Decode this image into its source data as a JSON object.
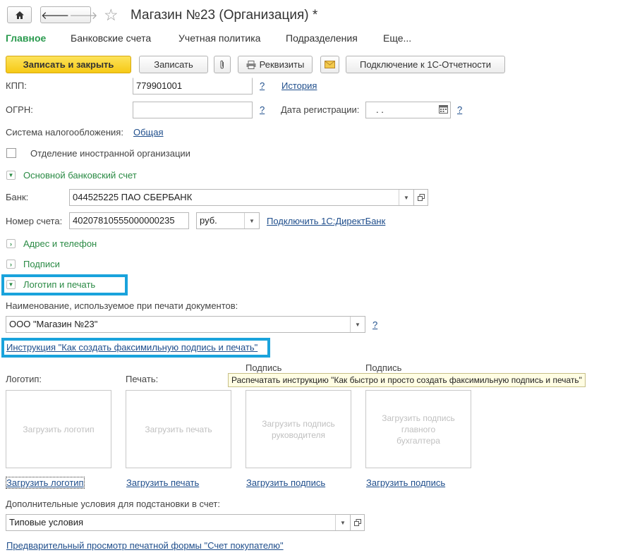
{
  "window": {
    "title": "Магазин №23 (Организация) *",
    "home_icon": "home-icon",
    "back_icon": "arrow-left-icon",
    "forward_icon": "arrow-right-icon",
    "favorite_icon": "star-icon"
  },
  "tabs": [
    {
      "label": "Главное",
      "active": true
    },
    {
      "label": "Банковские счета"
    },
    {
      "label": "Учетная политика"
    },
    {
      "label": "Подразделения"
    },
    {
      "label": "Еще..."
    }
  ],
  "toolbar": {
    "save_close": "Записать и закрыть",
    "save": "Записать",
    "details": "Реквизиты",
    "connect": "Подключение к 1С-Отчетности"
  },
  "fields": {
    "kpp_label": "КПП:",
    "kpp_value": "779901001",
    "ogrn_label": "ОГРН:",
    "ogrn_value": "",
    "help": "?",
    "history_link": "История",
    "reg_date_label": "Дата регистрации:",
    "reg_date_value": " .  .",
    "tax_label": "Система налогообложения:",
    "tax_link": "Общая",
    "foreign_checkbox_label": "Отделение иностранной организации"
  },
  "bank_group": {
    "title": "Основной банковский счет",
    "bank_label": "Банк:",
    "bank_value": "044525225 ПАО СБЕРБАНК",
    "account_label": "Номер счета:",
    "account_value": "40207810555000000235",
    "currency_value": "руб.",
    "directbank_link": "Подключить 1С:ДиректБанк"
  },
  "groups": {
    "address": "Адрес и телефон",
    "signatures": "Подписи",
    "logo": "Логотип и печать"
  },
  "logo_section": {
    "print_name_label": "Наименование, используемое при печати документов:",
    "print_name_value": "ООО \"Магазин №23\"",
    "instruction_link": "Инструкция \"Как создать факсимильную подпись и печать\"",
    "tooltip": "Распечатать инструкцию \"Как быстро и просто создать факсимильную подпись и печать\"",
    "images": [
      {
        "title": "Логотип:",
        "placeholder": "Загрузить логотип",
        "link": "Загрузить логотип"
      },
      {
        "title": "Печать:",
        "placeholder": "Загрузить печать",
        "link": "Загрузить печать"
      },
      {
        "title": "Подпись",
        "placeholder": "Загрузить  подпись руководителя",
        "link": "Загрузить подпись"
      },
      {
        "title": "Подпись",
        "placeholder": "Загрузить подпись главного бухгалтера",
        "link": "Загрузить подпись"
      }
    ],
    "conditions_label": "Дополнительные условия для подстановки в счет:",
    "conditions_value": "Типовые условия",
    "preview_link": "Предварительный просмотр печатной формы \"Счет покупателю\""
  },
  "colors": {
    "accent_green": "#2a9a4e",
    "primary_button": "#f6c915",
    "highlight_frame": "#1aa3dc",
    "link": "#1f4e8c"
  }
}
